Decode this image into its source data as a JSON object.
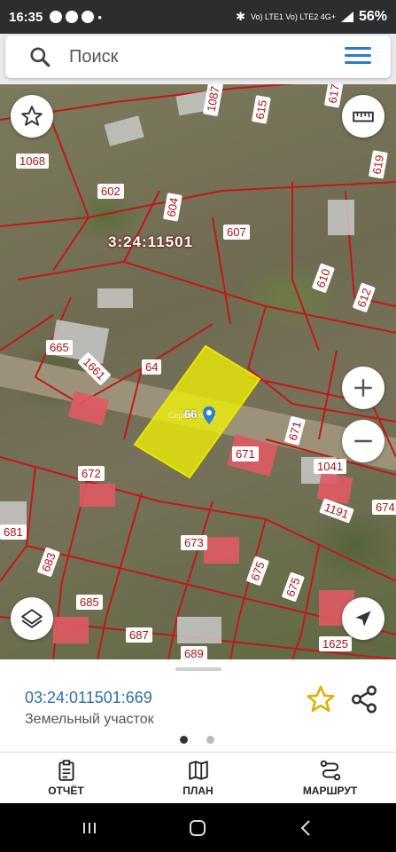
{
  "status": {
    "time": "16:35",
    "dot": "•",
    "network": "Vo) LTE1 Vo) LTE2 4G+",
    "battery": "56%"
  },
  "search": {
    "placeholder": "Поиск"
  },
  "map": {
    "block_label": "3:24:11501",
    "selected_label": "66",
    "watermark": "Сервис плюс",
    "plots": [
      "1068",
      "602",
      "1087",
      "615",
      "617",
      "619",
      "604",
      "607",
      "610",
      "612",
      "665",
      "1661",
      "64",
      "671",
      "671",
      "1041",
      "1191",
      "674",
      "672",
      "673",
      "675",
      "675",
      "683",
      "685",
      "687",
      "689",
      "1625",
      "681"
    ],
    "colors": {
      "boundary": "#c41717",
      "selection": "#ffff00",
      "label_text": "#b01111"
    }
  },
  "sheet": {
    "cadastral_number": "03:24:011501:669",
    "type": "Земельный участок",
    "page_dots": 2,
    "active_dot": 0
  },
  "toolbar": {
    "report": "ОТЧЁТ",
    "plan": "ПЛАН",
    "route": "МАРШРУТ"
  },
  "icons": {
    "search": "search-icon",
    "menu": "hamburger-menu-icon",
    "favorite": "star-icon",
    "ruler": "ruler-icon",
    "zoom_in": "plus-icon",
    "zoom_out": "minus-icon",
    "layers": "layers-icon",
    "location": "navigation-arrow-icon",
    "share": "share-icon",
    "report": "clipboard-icon",
    "plan": "map-icon",
    "route": "route-icon"
  }
}
